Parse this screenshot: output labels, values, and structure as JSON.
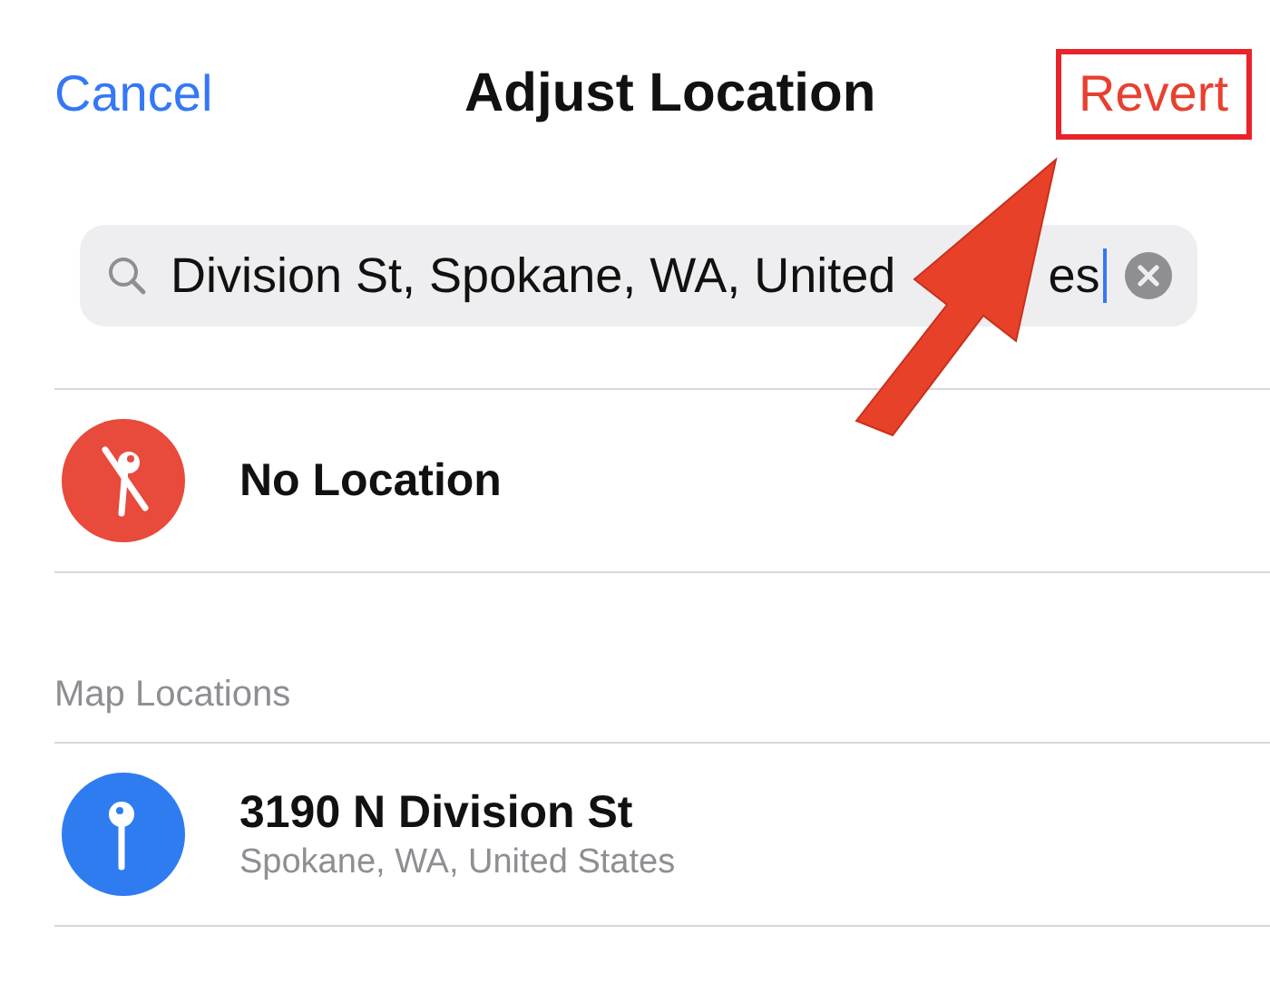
{
  "nav": {
    "cancel": "Cancel",
    "title": "Adjust Location",
    "revert": "Revert",
    "revert_highlighted": true
  },
  "search": {
    "value_parts": [
      "Division St, Spokane, WA, United",
      "es"
    ]
  },
  "no_location": {
    "label": "No Location"
  },
  "section_header": "Map Locations",
  "locations": [
    {
      "title": "3190 N Division St",
      "subtitle": "Spokane, WA, United States"
    }
  ],
  "annotation": {
    "kind": "arrow"
  }
}
